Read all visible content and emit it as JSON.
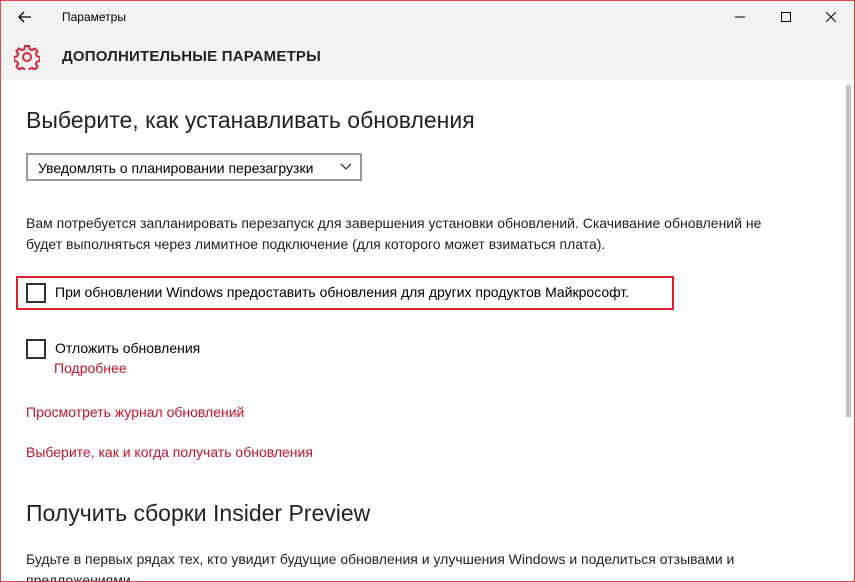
{
  "titlebar": {
    "app_title": "Параметры"
  },
  "header": {
    "section_title": "ДОПОЛНИТЕЛЬНЫЕ ПАРАМЕТРЫ"
  },
  "updates": {
    "heading": "Выберите, как устанавливать обновления",
    "dropdown_value": "Уведомлять о планировании перезагрузки",
    "description_line1": "Вам потребуется запланировать перезапуск для завершения установки обновлений. Скачивание обновлений не",
    "description_line2": "будет выполняться через лимитное подключение (для которого может взиматься плата).",
    "checkbox_other_products": "При обновлении Windows предоставить обновления для других продуктов Майкрософт.",
    "checkbox_defer": "Отложить обновления",
    "link_more": "Подробнее",
    "link_history": "Просмотреть журнал обновлений",
    "link_choose": "Выберите, как и когда получать обновления"
  },
  "insider": {
    "heading": "Получить сборки Insider Preview",
    "description_line1": "Будьте в первых рядах тех, кто увидит будущие обновления и улучшения Windows и поделиться отзывами и",
    "description_line2": "предложениями"
  },
  "colors": {
    "accent": "#c4122e",
    "highlight_border": "#e01e2e",
    "titlebar_bg": "#f2f2f2"
  }
}
